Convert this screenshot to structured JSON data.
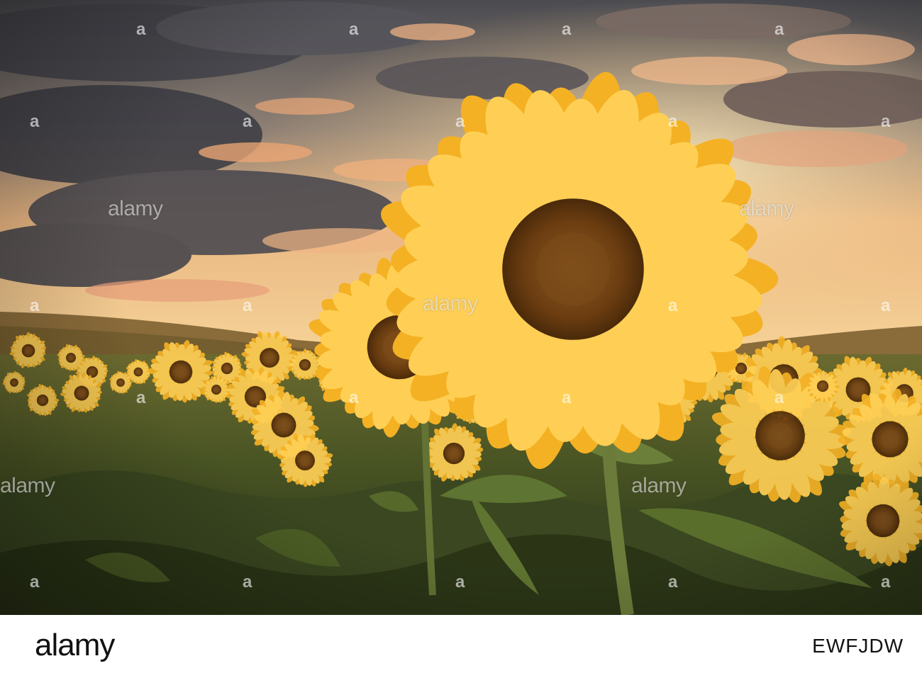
{
  "photo": {
    "subject": "sunflower field at sunset",
    "colors": {
      "sky_top": "#4a4a4f",
      "sky_glow": "#f6c98a",
      "cloud_dark": "#3f3f46",
      "cloud_lit": "#f0a873",
      "hills": "#8a6b3a",
      "foliage_dark": "#2f3a1c",
      "foliage": "#55662c",
      "petal": "#f4b124",
      "petal_lit": "#ffcf55",
      "disk": "#6b3f12"
    }
  },
  "watermark": {
    "brand": "alamy",
    "mark": "a"
  },
  "footer": {
    "logo": "alamy",
    "image_id": "EWFJDW"
  }
}
